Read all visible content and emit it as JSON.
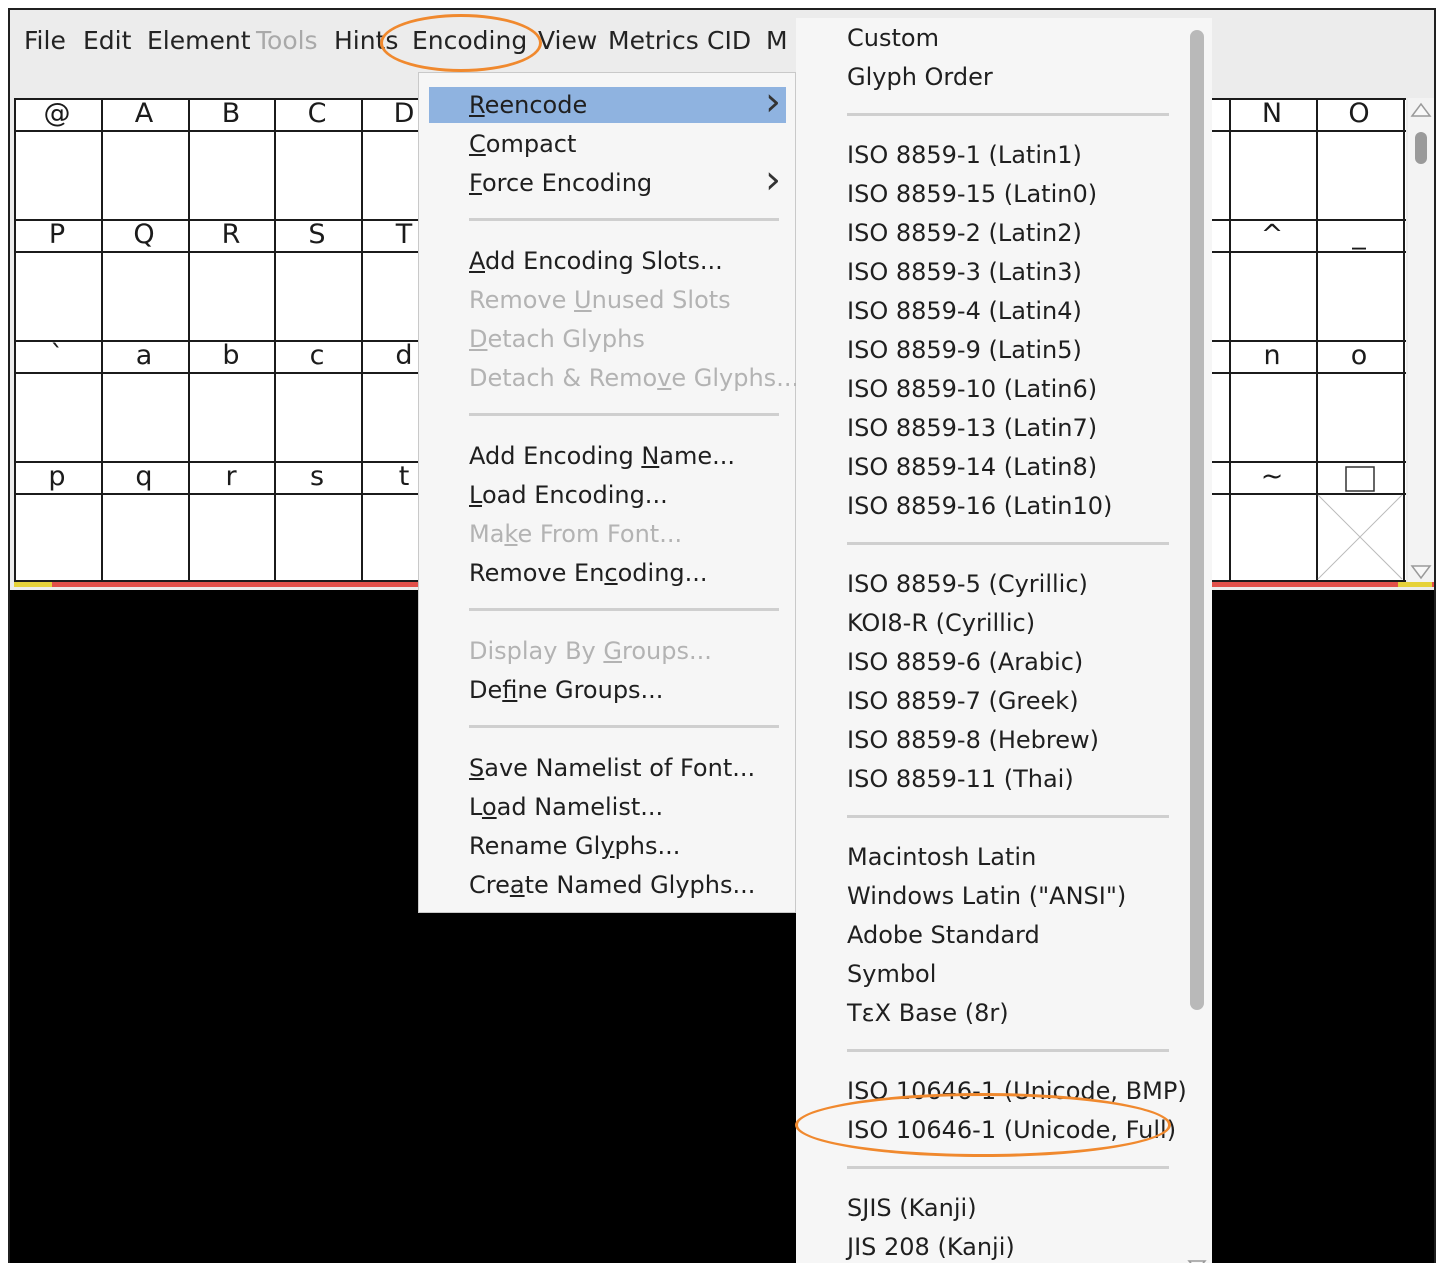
{
  "menubar": [
    "File",
    "Edit",
    "Element",
    "Tools",
    "Hints",
    "Encoding",
    "View",
    "Metrics",
    "CID",
    "M"
  ],
  "menubar_disabled": [
    "Tools"
  ],
  "grid": {
    "rows": [
      [
        "@",
        "A",
        "B",
        "C",
        "D",
        "",
        "",
        "",
        "",
        "",
        "",
        "",
        "",
        "",
        "N",
        "O"
      ],
      [
        "P",
        "Q",
        "R",
        "S",
        "T",
        "",
        "",
        "",
        "",
        "",
        "",
        "",
        "",
        "",
        "^",
        "_"
      ],
      [
        "`",
        "a",
        "b",
        "c",
        "d",
        "",
        "",
        "",
        "",
        "",
        "",
        "",
        "",
        "",
        "n",
        "o"
      ],
      [
        "p",
        "q",
        "r",
        "s",
        "t",
        "",
        "",
        "",
        "",
        "",
        "",
        "",
        "",
        "",
        "~",
        ""
      ]
    ]
  },
  "encoding_menu": {
    "items": [
      {
        "label": "Reencode",
        "mnemonic": "R",
        "highlighted": true,
        "submenu": true
      },
      {
        "label": "Compact",
        "mnemonic": "C"
      },
      {
        "label": "Force Encoding",
        "mnemonic": "F",
        "submenu": true
      },
      {
        "label": "Add Encoding Slots...",
        "mnemonic": "A"
      },
      {
        "label": "Remove Unused Slots",
        "mnemonic": "U",
        "disabled": true
      },
      {
        "label": "Detach Glyphs",
        "mnemonic": "D",
        "disabled": true
      },
      {
        "label": "Detach & Remove Glyphs...",
        "mnemonic": "v",
        "disabled": true
      },
      {
        "label": "Add Encoding Name...",
        "mnemonic": "N"
      },
      {
        "label": "Load Encoding...",
        "mnemonic": "L"
      },
      {
        "label": "Make From Font...",
        "mnemonic": "k",
        "disabled": true
      },
      {
        "label": "Remove Encoding...",
        "mnemonic": "c"
      },
      {
        "label": "Display By Groups...",
        "mnemonic": "G",
        "disabled": true
      },
      {
        "label": "Define Groups...",
        "mnemonic": "f"
      },
      {
        "label": "Save Namelist of Font...",
        "mnemonic": "S"
      },
      {
        "label": "Load Namelist...",
        "mnemonic": "o"
      },
      {
        "label": "Rename Glyphs...",
        "mnemonic": "y"
      },
      {
        "label": "Create Named Glyphs...",
        "mnemonic": "a"
      }
    ]
  },
  "reencode_submenu": {
    "items": [
      "Custom",
      "Glyph Order",
      "ISO 8859-1  (Latin1)",
      "ISO 8859-15  (Latin0)",
      "ISO 8859-2  (Latin2)",
      "ISO 8859-3  (Latin3)",
      "ISO 8859-4  (Latin4)",
      "ISO 8859-9  (Latin5)",
      "ISO 8859-10  (Latin6)",
      "ISO 8859-13  (Latin7)",
      "ISO 8859-14  (Latin8)",
      "ISO 8859-16  (Latin10)",
      "ISO 8859-5 (Cyrillic)",
      "KOI8-R (Cyrillic)",
      "ISO 8859-6 (Arabic)",
      "ISO 8859-7 (Greek)",
      "ISO 8859-8 (Hebrew)",
      "ISO 8859-11 (Thai)",
      "Macintosh Latin",
      "Windows Latin (\"ANSI\")",
      "Adobe Standard",
      "Symbol",
      "TεX Base (8r)",
      "ISO 10646-1 (Unicode, BMP)",
      "ISO 10646-1 (Unicode, Full)",
      "SJIS (Kanji)",
      "JIS 208 (Kanji)"
    ],
    "highlighted_annotation": "ISO 10646-1 (Unicode, Full)"
  },
  "colors": {
    "highlight": "#8fb3e0",
    "annotation": "#f0892e",
    "disabled": "#b3b3b3"
  }
}
